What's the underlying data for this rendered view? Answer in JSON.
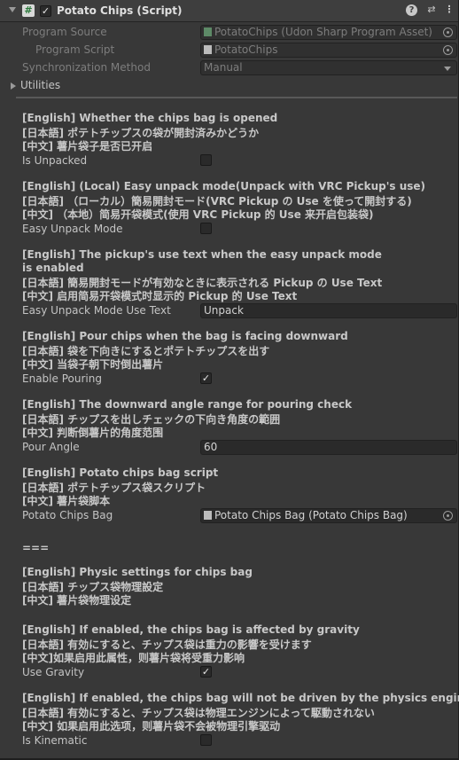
{
  "component": {
    "title": "Potato Chips (Script)",
    "icon_glyph": "#",
    "enabled_mark": "✓",
    "help_glyph": "?",
    "settings_glyph": "⇄",
    "more_glyph": "⋮",
    "icons": [
      "script-icon",
      "help-icon",
      "presets-icon",
      "more-menu-icon"
    ]
  },
  "program_source": {
    "label": "Program Source",
    "value": "PotatoChips (Udon Sharp Program Asset)"
  },
  "program_script": {
    "label": "Program Script",
    "value": "PotatoChips"
  },
  "sync_method": {
    "label": "Synchronization Method",
    "value": "Manual"
  },
  "utilities": {
    "label": "Utilities"
  },
  "fields": {
    "is_unpacked": {
      "desc": [
        "[English] Whether the chips bag is opened",
        "[日本語] ポテトチップスの袋が開封済みかどうか",
        "[中文] 薯片袋子是否已开启"
      ],
      "label": "Is Unpacked",
      "checked": false
    },
    "easy_unpack": {
      "desc": [
        "[English] (Local) Easy unpack mode(Unpack with VRC Pickup's use)",
        "[日本語] （ローカル）簡易開封モード(VRC Pickup の Use を使って開封する)",
        "[中文] （本地）简易开袋模式(使用 VRC Pickup 的 Use 来开启包装袋)"
      ],
      "label": "Easy Unpack Mode",
      "checked": false
    },
    "easy_unpack_text": {
      "desc": [
        "[English] The pickup's use text when the easy unpack mode",
        "is enabled",
        "[日本語] 簡易開封モードが有効なときに表示される Pickup の Use Text",
        "[中文] 启用简易开袋模式时显示的 Pickup 的 Use Text"
      ],
      "label": "Easy Unpack Mode Use Text",
      "value": "Unpack"
    },
    "enable_pouring": {
      "desc": [
        "[English] Pour chips when the bag is facing downward",
        "[日本語] 袋を下向きにするとポテトチップスを出す",
        "[中文] 当袋子朝下时倒出薯片"
      ],
      "label": "Enable Pouring",
      "checked": true,
      "check_mark": "✓"
    },
    "pour_angle": {
      "desc": [
        "[English] The downward angle range for pouring check",
        "[日本語] チップスを出しチェックの下向き角度の範囲",
        "[中文] 判断倒薯片的角度范围"
      ],
      "label": "Pour Angle",
      "value": "60"
    },
    "chips_bag": {
      "desc": [
        "[English] Potato chips bag script",
        "[日本語] ポテトチップス袋スクリプト",
        "[中文] 薯片袋脚本"
      ],
      "label": "Potato Chips Bag",
      "value": "Potato Chips Bag (Potato Chips Bag)"
    },
    "divider_text": "===",
    "physics_header": [
      "[English] Physic settings for chips bag",
      "[日本語] チップス袋物理設定",
      "[中文] 薯片袋物理设定"
    ],
    "use_gravity": {
      "desc": [
        "[English] If enabled, the chips bag is affected by gravity",
        "[日本語] 有効にすると、チップス袋は重力の影響を受けます",
        "[中文]如果启用此属性，则薯片袋将受重力影响"
      ],
      "label": "Use Gravity",
      "checked": true,
      "check_mark": "✓"
    },
    "is_kinematic": {
      "desc": [
        "[English] If enabled, the chips bag will not be driven by the physics engine",
        "[日本語] 有効にすると、チップス袋は物理エンジンによって駆動されない",
        "[中文] 如果启用此选项，则薯片袋不会被物理引擎驱动"
      ],
      "label": "Is Kinematic",
      "checked": false
    }
  }
}
